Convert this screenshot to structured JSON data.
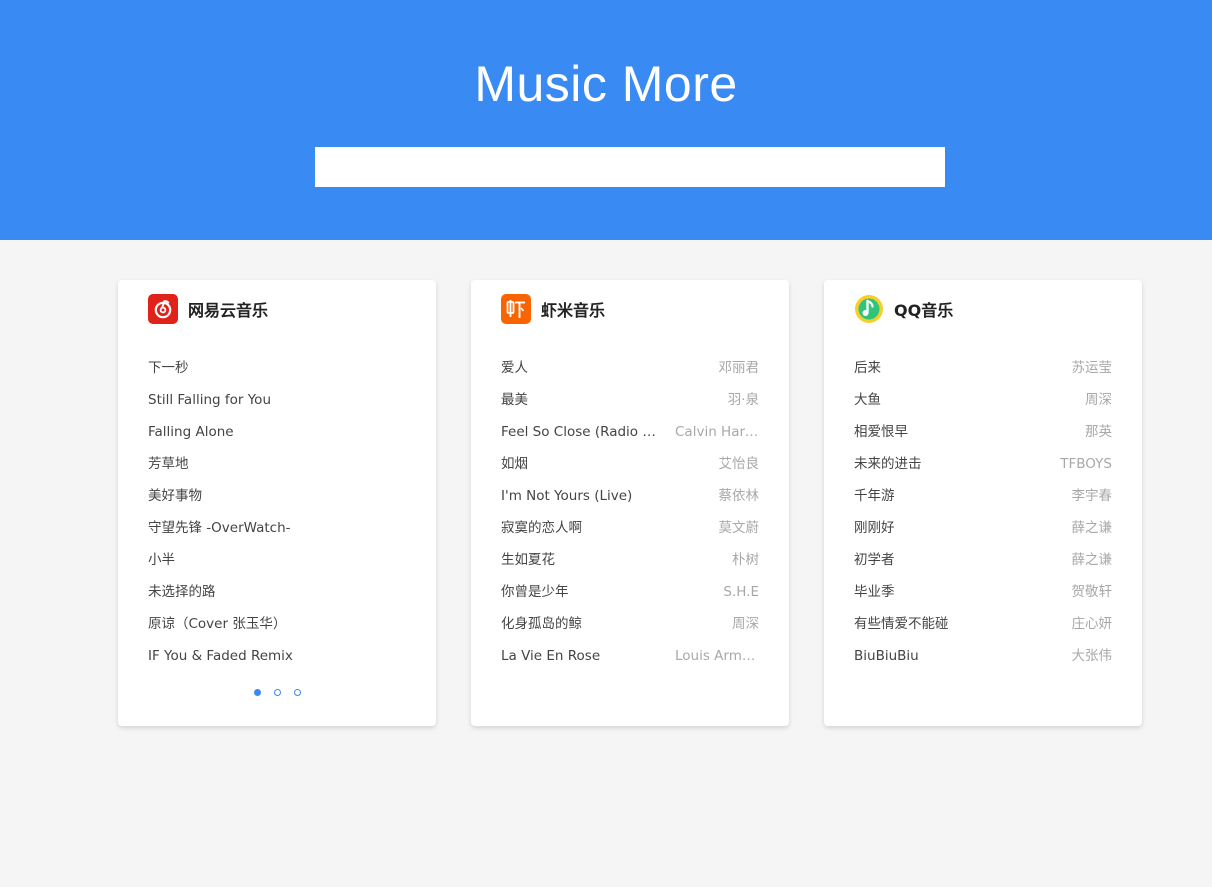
{
  "app": {
    "title": "Music More"
  },
  "search": {
    "value": "",
    "placeholder": ""
  },
  "colors": {
    "header": "#3a8af3",
    "page_bg": "#f5f5f5",
    "netease_brand": "#e0221a",
    "xiami_brand": "#fa6400",
    "qq_brand": "#31c27c"
  },
  "cards": [
    {
      "id": "netease",
      "name": "网易云音乐",
      "icon": "netease-cloud-music-logo",
      "songs": [
        {
          "title": "下一秒",
          "artist": ""
        },
        {
          "title": "Still Falling for You",
          "artist": ""
        },
        {
          "title": "Falling Alone",
          "artist": ""
        },
        {
          "title": "芳草地",
          "artist": ""
        },
        {
          "title": "美好事物",
          "artist": ""
        },
        {
          "title": "守望先锋 -OverWatch-",
          "artist": ""
        },
        {
          "title": "小半",
          "artist": ""
        },
        {
          "title": "未选择的路",
          "artist": ""
        },
        {
          "title": "原谅（Cover 张玉华）",
          "artist": ""
        },
        {
          "title": "IF You & Faded Remix",
          "artist": ""
        }
      ],
      "pager": {
        "pages": 3,
        "active": 1
      }
    },
    {
      "id": "xiami",
      "name": "虾米音乐",
      "icon": "xiami-music-logo",
      "songs": [
        {
          "title": "爱人",
          "artist": "邓丽君"
        },
        {
          "title": "最美",
          "artist": "羽·泉"
        },
        {
          "title": "Feel So Close (Radio Edit)",
          "artist": "Calvin Harris"
        },
        {
          "title": "如烟",
          "artist": "艾怡良"
        },
        {
          "title": "I'm Not Yours (Live)",
          "artist": "蔡依林"
        },
        {
          "title": "寂寞的恋人啊",
          "artist": "莫文蔚"
        },
        {
          "title": "生如夏花",
          "artist": "朴树"
        },
        {
          "title": "你曾是少年",
          "artist": "S.H.E"
        },
        {
          "title": "化身孤岛的鲸",
          "artist": "周深"
        },
        {
          "title": "La Vie En Rose",
          "artist": "Louis Armstrong"
        }
      ]
    },
    {
      "id": "qq",
      "name": "QQ音乐",
      "icon": "qq-music-logo",
      "songs": [
        {
          "title": "后来",
          "artist": "苏运莹"
        },
        {
          "title": "大鱼",
          "artist": "周深"
        },
        {
          "title": "相爱恨早",
          "artist": "那英"
        },
        {
          "title": "未来的进击",
          "artist": "TFBOYS"
        },
        {
          "title": "千年游",
          "artist": "李宇春"
        },
        {
          "title": "刚刚好",
          "artist": "薛之谦"
        },
        {
          "title": "初学者",
          "artist": "薛之谦"
        },
        {
          "title": "毕业季",
          "artist": "贺敬轩"
        },
        {
          "title": "有些情爱不能碰",
          "artist": "庄心妍"
        },
        {
          "title": "BiuBiuBiu",
          "artist": "大张伟"
        }
      ]
    }
  ]
}
